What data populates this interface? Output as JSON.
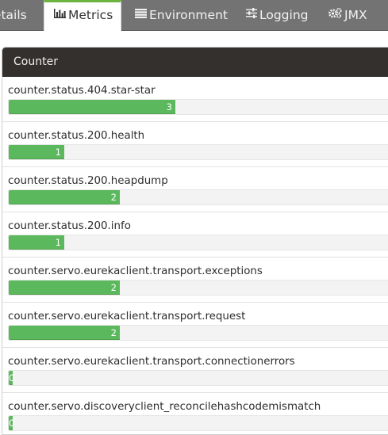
{
  "tabs": [
    {
      "label": "Details",
      "icon": "none",
      "active": false
    },
    {
      "label": "Metrics",
      "icon": "bar-chart-icon",
      "active": true
    },
    {
      "label": "Environment",
      "icon": "list-icon",
      "active": false
    },
    {
      "label": "Logging",
      "icon": "sliders-icon",
      "active": false
    },
    {
      "label": "JMX",
      "icon": "gears-icon",
      "active": false
    }
  ],
  "panel": {
    "title": "Counter"
  },
  "counters": {
    "max_value": 7,
    "items": [
      {
        "name": "counter.status.404.star-star",
        "value": "3"
      },
      {
        "name": "counter.status.200.health",
        "value": "1"
      },
      {
        "name": "counter.status.200.heapdump",
        "value": "2"
      },
      {
        "name": "counter.status.200.info",
        "value": "1"
      },
      {
        "name": "counter.servo.eurekaclient.transport.exceptions",
        "value": "2"
      },
      {
        "name": "counter.servo.eurekaclient.transport.request",
        "value": "2"
      },
      {
        "name": "counter.servo.eurekaclient.transport.connectionerrors",
        "value": "0"
      },
      {
        "name": "counter.servo.discoveryclient_reconcilehashcodemismatch",
        "value": "0"
      }
    ]
  },
  "colors": {
    "accent": "#6db33f",
    "bar": "#5cb85c",
    "header": "#34302d",
    "tabbar": "#737373"
  }
}
